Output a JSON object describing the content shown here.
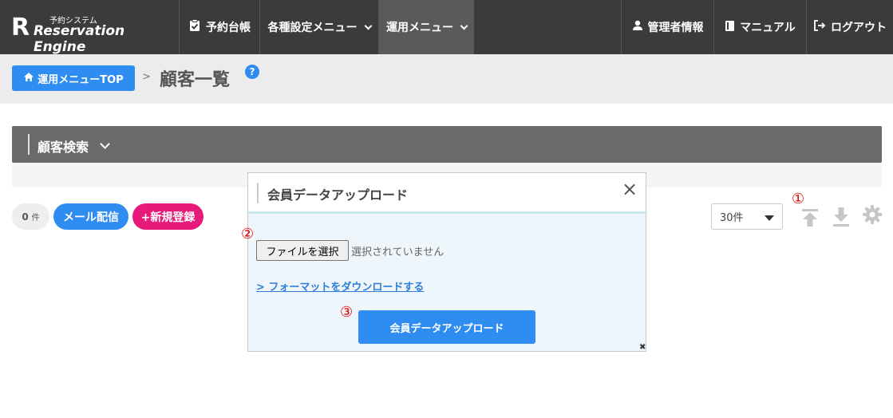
{
  "brand": {
    "mark": "R",
    "sub": "予約システム",
    "name": "Reservation Engine"
  },
  "nav": {
    "items": [
      {
        "label": "予約台帳",
        "icon": "clipboard-check-icon"
      },
      {
        "label": "各種設定メニュー",
        "icon": "chevron-down-icon"
      },
      {
        "label": "運用メニュー",
        "icon": "chevron-down-icon"
      }
    ],
    "right": [
      {
        "label": "管理者情報",
        "icon": "user-icon"
      },
      {
        "label": "マニュアル",
        "icon": "book-icon"
      },
      {
        "label": "ログアウト",
        "icon": "logout-icon"
      }
    ]
  },
  "breadcrumb": {
    "home_label": "運用メニューTOP",
    "separator": ">",
    "title": "顧客一覧",
    "help": "?"
  },
  "search": {
    "title": "顧客検索"
  },
  "actions": {
    "count": "0",
    "count_unit": "件",
    "mail_label": "メール配信",
    "new_label": "+新規登録",
    "per_page": "30件"
  },
  "annotations": {
    "one": "①",
    "two": "②",
    "three": "③"
  },
  "modal": {
    "title": "会員データアップロード",
    "close": "×",
    "file_button": "ファイルを選択",
    "file_status": "選択されていません",
    "format_link": "> フォーマットをダウンロードする",
    "submit": "会員データアップロード",
    "resize": "✖"
  },
  "colors": {
    "nav_bg": "#3b3b3b",
    "primary": "#2f8cf0",
    "accent_pink": "#e7197a",
    "annotation_red": "#e00000"
  }
}
